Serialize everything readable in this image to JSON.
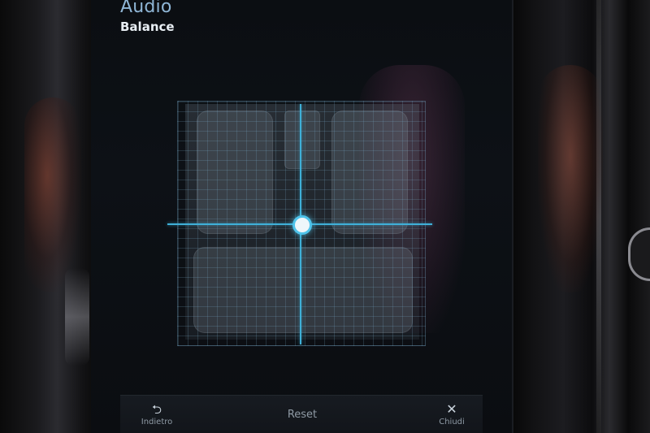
{
  "header": {
    "app_title": "Audio",
    "page_title": "Balance"
  },
  "balance": {
    "left_right": 0.0,
    "front_rear": 0.0
  },
  "bottom_bar": {
    "back_label": "Indietro",
    "back_icon": "return-arrow-icon",
    "back_glyph": "⮌",
    "reset_label": "Reset",
    "close_label": "Chiudi",
    "close_icon": "close-icon",
    "close_glyph": "✕"
  },
  "colors": {
    "accent": "#3fb0d8",
    "title": "#8fb6d6"
  }
}
